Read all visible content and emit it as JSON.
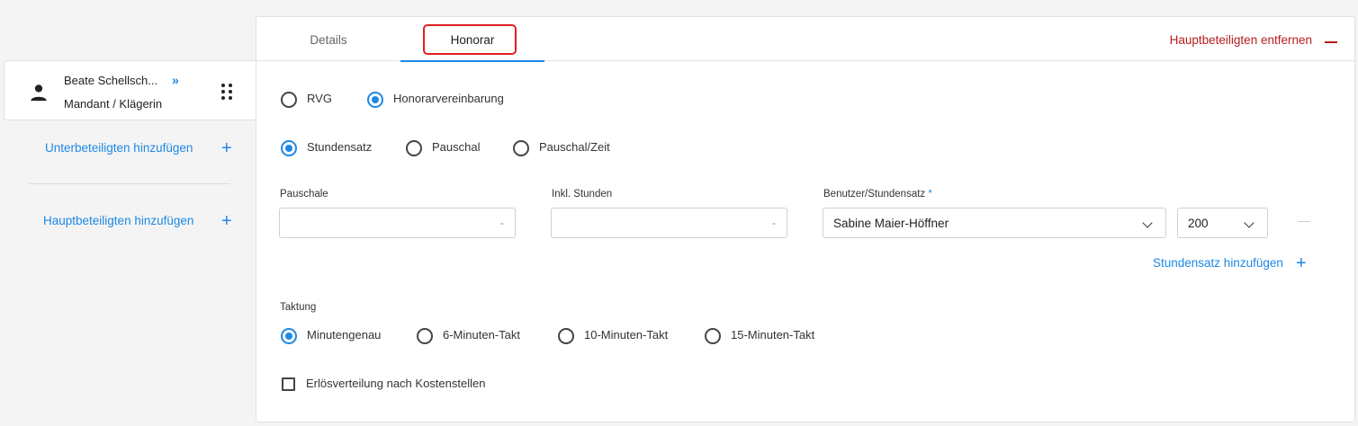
{
  "party": {
    "name": "Beate Schellsch...",
    "expand_glyph": "»",
    "role": "Mandant / Klägerin"
  },
  "left_links": {
    "add_sub_party": "Unterbeteiligten hinzufügen",
    "add_main_party": "Hauptbeteiligten hinzufügen",
    "plus": "+"
  },
  "tabs": [
    {
      "label": "Details",
      "active": false
    },
    {
      "label": "Honorar",
      "active": true
    }
  ],
  "remove_main_party": "Hauptbeteiligten entfernen",
  "fee_type": {
    "options": [
      {
        "label": "RVG",
        "selected": false
      },
      {
        "label": "Honorarvereinbarung",
        "selected": true
      }
    ]
  },
  "billing_mode": {
    "options": [
      {
        "label": "Stundensatz",
        "selected": true
      },
      {
        "label": "Pauschal",
        "selected": false
      },
      {
        "label": "Pauschal/Zeit",
        "selected": false
      }
    ]
  },
  "fields": {
    "pauschale": {
      "label": "Pauschale",
      "value": "-"
    },
    "inkl_stunden": {
      "label": "Inkl. Stunden",
      "value": "-"
    },
    "benutzer": {
      "label": "Benutzer/Stundensatz",
      "required": "*",
      "value": "Sabine Maier-Höffner"
    },
    "rate": {
      "value": "200"
    }
  },
  "add_rate": "Stundensatz hinzufügen",
  "taktung": {
    "label": "Taktung",
    "options": [
      {
        "label": "Minutengenau",
        "selected": true
      },
      {
        "label": "6-Minuten-Takt",
        "selected": false
      },
      {
        "label": "10-Minuten-Takt",
        "selected": false
      },
      {
        "label": "15-Minuten-Takt",
        "selected": false
      }
    ]
  },
  "cost_center_checkbox": {
    "label": "Erlösverteilung nach Kostenstellen",
    "checked": false
  },
  "colors": {
    "accent": "#1e88e5",
    "danger": "#b71c1c",
    "highlight": "#e02020"
  },
  "icons": [
    "person-icon",
    "drag-handle-icon",
    "chevron-down-icon",
    "plus-icon",
    "minus-icon"
  ]
}
